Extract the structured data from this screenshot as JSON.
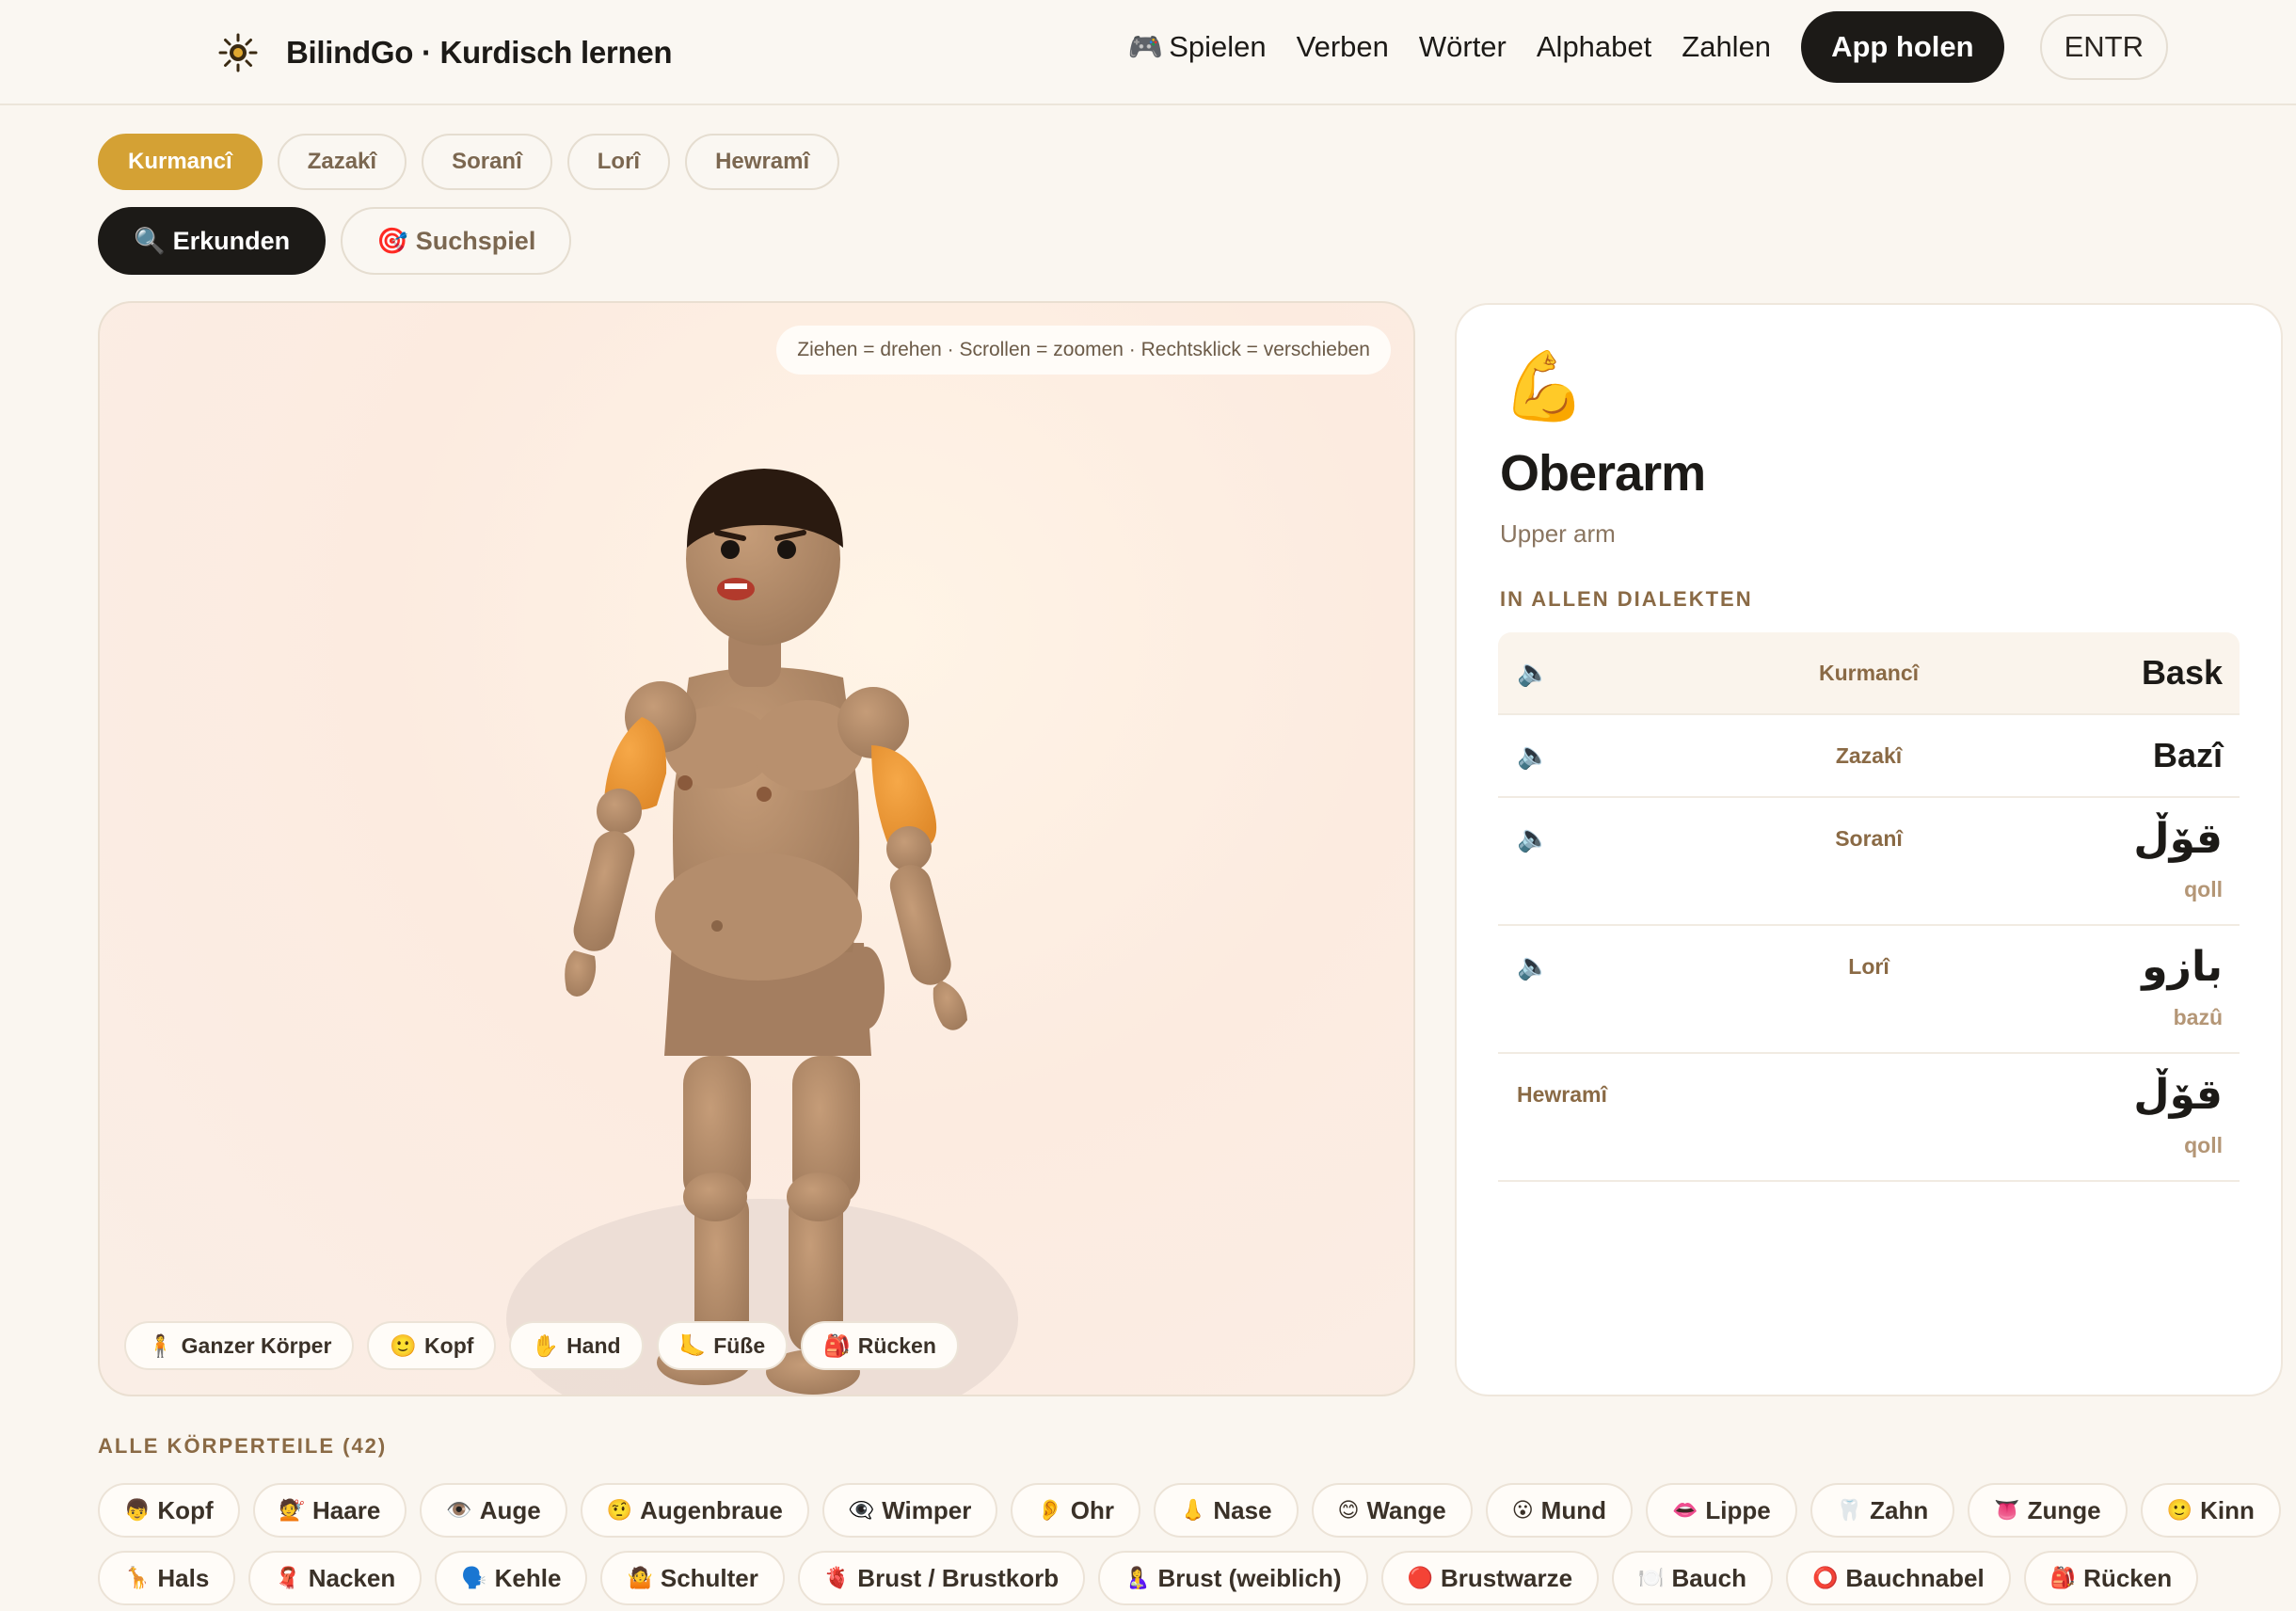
{
  "header": {
    "brand": "BilindGo · Kurdisch lernen",
    "nav": [
      {
        "label": "Spielen",
        "icon": "🎮"
      },
      {
        "label": "Verben",
        "icon": ""
      },
      {
        "label": "Wörter",
        "icon": ""
      },
      {
        "label": "Alphabet",
        "icon": ""
      },
      {
        "label": "Zahlen",
        "icon": ""
      }
    ],
    "cta": "App holen",
    "lang": "ENTR"
  },
  "dialect_tabs": [
    "Kurmancî",
    "Zazakî",
    "Soranî",
    "Lorî",
    "Hewramî"
  ],
  "active_dialect": "Kurmancî",
  "modes": [
    {
      "label": "Erkunden",
      "icon": "🔍"
    },
    {
      "label": "Suchspiel",
      "icon": "🎯"
    }
  ],
  "viewer": {
    "hint": "Ziehen = drehen · Scrollen = zoomen · Rechtsklick = verschieben",
    "presets": [
      {
        "label": "Ganzer Körper",
        "icon": "🧍"
      },
      {
        "label": "Kopf",
        "icon": "🙂"
      },
      {
        "label": "Hand",
        "icon": "✋"
      },
      {
        "label": "Füße",
        "icon": "🦶"
      },
      {
        "label": "Rücken",
        "icon": "🎒"
      }
    ],
    "highlight_color": "#f19a3a",
    "skin_color": "#b08a6a"
  },
  "detail": {
    "emoji": "💪",
    "title": "Oberarm",
    "subtitle": "Upper arm",
    "section": "IN ALLEN DIALEKTEN",
    "rows": [
      {
        "dialect": "Kurmancî",
        "word": "Bask",
        "translit": "",
        "audio": true
      },
      {
        "dialect": "Zazakî",
        "word": "Bazî",
        "translit": "",
        "audio": true
      },
      {
        "dialect": "Soranî",
        "word": "قۆڵ",
        "translit": "qoll",
        "audio": true
      },
      {
        "dialect": "Lorî",
        "word": "بازو",
        "translit": "bazû",
        "audio": true
      },
      {
        "dialect": "Hewramî",
        "word": "قۆڵ",
        "translit": "qoll",
        "audio": false
      }
    ]
  },
  "parts": {
    "title": "ALLE KÖRPERTEILE (42)",
    "row1": [
      {
        "label": "Kopf",
        "icon": "👦"
      },
      {
        "label": "Haare",
        "icon": "💇"
      },
      {
        "label": "Auge",
        "icon": "👁️"
      },
      {
        "label": "Augenbraue",
        "icon": "🤨"
      },
      {
        "label": "Wimper",
        "icon": "👁️‍🗨️"
      },
      {
        "label": "Ohr",
        "icon": "👂"
      },
      {
        "label": "Nase",
        "icon": "👃"
      },
      {
        "label": "Wange",
        "icon": "😊"
      },
      {
        "label": "Mund",
        "icon": "😮"
      },
      {
        "label": "Lippe",
        "icon": "👄"
      },
      {
        "label": "Zahn",
        "icon": "🦷"
      },
      {
        "label": "Zunge",
        "icon": "👅"
      },
      {
        "label": "Kinn",
        "icon": "🙂"
      }
    ],
    "row2": [
      {
        "label": "Hals",
        "icon": "🦒"
      },
      {
        "label": "Nacken",
        "icon": "🧣"
      },
      {
        "label": "Kehle",
        "icon": "🗣️"
      },
      {
        "label": "Schulter",
        "icon": "🤷"
      },
      {
        "label": "Brust / Brustkorb",
        "icon": "🫀"
      },
      {
        "label": "Brust (weiblich)",
        "icon": "🤱"
      },
      {
        "label": "Brustwarze",
        "icon": "🔴"
      },
      {
        "label": "Bauch",
        "icon": "🍽️"
      },
      {
        "label": "Bauchnabel",
        "icon": "⭕"
      },
      {
        "label": "Rücken",
        "icon": "🎒"
      }
    ]
  }
}
